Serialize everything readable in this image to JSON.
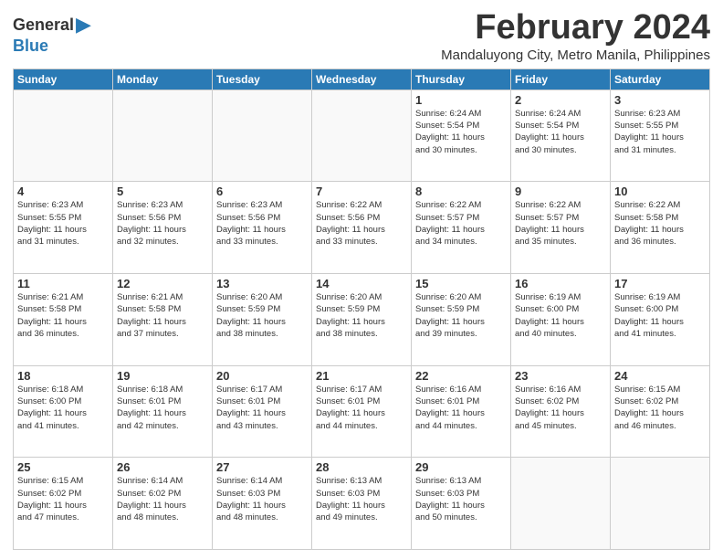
{
  "logo": {
    "general": "General",
    "blue": "Blue"
  },
  "title": "February 2024",
  "subtitle": "Mandaluyong City, Metro Manila, Philippines",
  "weekdays": [
    "Sunday",
    "Monday",
    "Tuesday",
    "Wednesday",
    "Thursday",
    "Friday",
    "Saturday"
  ],
  "weeks": [
    [
      {
        "day": "",
        "info": ""
      },
      {
        "day": "",
        "info": ""
      },
      {
        "day": "",
        "info": ""
      },
      {
        "day": "",
        "info": ""
      },
      {
        "day": "1",
        "info": "Sunrise: 6:24 AM\nSunset: 5:54 PM\nDaylight: 11 hours\nand 30 minutes."
      },
      {
        "day": "2",
        "info": "Sunrise: 6:24 AM\nSunset: 5:54 PM\nDaylight: 11 hours\nand 30 minutes."
      },
      {
        "day": "3",
        "info": "Sunrise: 6:23 AM\nSunset: 5:55 PM\nDaylight: 11 hours\nand 31 minutes."
      }
    ],
    [
      {
        "day": "4",
        "info": "Sunrise: 6:23 AM\nSunset: 5:55 PM\nDaylight: 11 hours\nand 31 minutes."
      },
      {
        "day": "5",
        "info": "Sunrise: 6:23 AM\nSunset: 5:56 PM\nDaylight: 11 hours\nand 32 minutes."
      },
      {
        "day": "6",
        "info": "Sunrise: 6:23 AM\nSunset: 5:56 PM\nDaylight: 11 hours\nand 33 minutes."
      },
      {
        "day": "7",
        "info": "Sunrise: 6:22 AM\nSunset: 5:56 PM\nDaylight: 11 hours\nand 33 minutes."
      },
      {
        "day": "8",
        "info": "Sunrise: 6:22 AM\nSunset: 5:57 PM\nDaylight: 11 hours\nand 34 minutes."
      },
      {
        "day": "9",
        "info": "Sunrise: 6:22 AM\nSunset: 5:57 PM\nDaylight: 11 hours\nand 35 minutes."
      },
      {
        "day": "10",
        "info": "Sunrise: 6:22 AM\nSunset: 5:58 PM\nDaylight: 11 hours\nand 36 minutes."
      }
    ],
    [
      {
        "day": "11",
        "info": "Sunrise: 6:21 AM\nSunset: 5:58 PM\nDaylight: 11 hours\nand 36 minutes."
      },
      {
        "day": "12",
        "info": "Sunrise: 6:21 AM\nSunset: 5:58 PM\nDaylight: 11 hours\nand 37 minutes."
      },
      {
        "day": "13",
        "info": "Sunrise: 6:20 AM\nSunset: 5:59 PM\nDaylight: 11 hours\nand 38 minutes."
      },
      {
        "day": "14",
        "info": "Sunrise: 6:20 AM\nSunset: 5:59 PM\nDaylight: 11 hours\nand 38 minutes."
      },
      {
        "day": "15",
        "info": "Sunrise: 6:20 AM\nSunset: 5:59 PM\nDaylight: 11 hours\nand 39 minutes."
      },
      {
        "day": "16",
        "info": "Sunrise: 6:19 AM\nSunset: 6:00 PM\nDaylight: 11 hours\nand 40 minutes."
      },
      {
        "day": "17",
        "info": "Sunrise: 6:19 AM\nSunset: 6:00 PM\nDaylight: 11 hours\nand 41 minutes."
      }
    ],
    [
      {
        "day": "18",
        "info": "Sunrise: 6:18 AM\nSunset: 6:00 PM\nDaylight: 11 hours\nand 41 minutes."
      },
      {
        "day": "19",
        "info": "Sunrise: 6:18 AM\nSunset: 6:01 PM\nDaylight: 11 hours\nand 42 minutes."
      },
      {
        "day": "20",
        "info": "Sunrise: 6:17 AM\nSunset: 6:01 PM\nDaylight: 11 hours\nand 43 minutes."
      },
      {
        "day": "21",
        "info": "Sunrise: 6:17 AM\nSunset: 6:01 PM\nDaylight: 11 hours\nand 44 minutes."
      },
      {
        "day": "22",
        "info": "Sunrise: 6:16 AM\nSunset: 6:01 PM\nDaylight: 11 hours\nand 44 minutes."
      },
      {
        "day": "23",
        "info": "Sunrise: 6:16 AM\nSunset: 6:02 PM\nDaylight: 11 hours\nand 45 minutes."
      },
      {
        "day": "24",
        "info": "Sunrise: 6:15 AM\nSunset: 6:02 PM\nDaylight: 11 hours\nand 46 minutes."
      }
    ],
    [
      {
        "day": "25",
        "info": "Sunrise: 6:15 AM\nSunset: 6:02 PM\nDaylight: 11 hours\nand 47 minutes."
      },
      {
        "day": "26",
        "info": "Sunrise: 6:14 AM\nSunset: 6:02 PM\nDaylight: 11 hours\nand 48 minutes."
      },
      {
        "day": "27",
        "info": "Sunrise: 6:14 AM\nSunset: 6:03 PM\nDaylight: 11 hours\nand 48 minutes."
      },
      {
        "day": "28",
        "info": "Sunrise: 6:13 AM\nSunset: 6:03 PM\nDaylight: 11 hours\nand 49 minutes."
      },
      {
        "day": "29",
        "info": "Sunrise: 6:13 AM\nSunset: 6:03 PM\nDaylight: 11 hours\nand 50 minutes."
      },
      {
        "day": "",
        "info": ""
      },
      {
        "day": "",
        "info": ""
      }
    ]
  ]
}
